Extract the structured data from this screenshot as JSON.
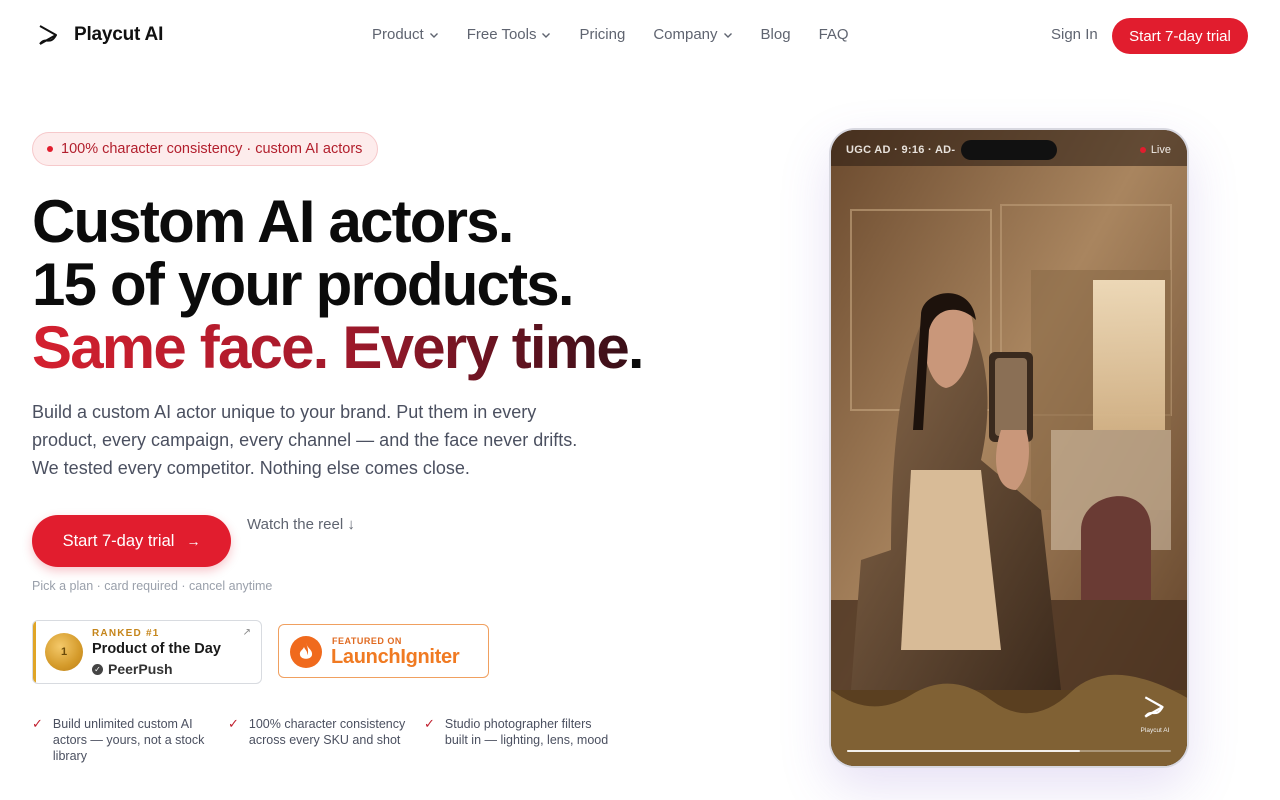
{
  "nav": {
    "brand": "Playcut AI",
    "items": [
      {
        "label": "Product",
        "dropdown": true
      },
      {
        "label": "Free Tools",
        "dropdown": true
      },
      {
        "label": "Pricing",
        "dropdown": false
      },
      {
        "label": "Company",
        "dropdown": true
      },
      {
        "label": "Blog",
        "dropdown": false
      },
      {
        "label": "FAQ",
        "dropdown": false
      }
    ],
    "sign_in": "Sign In",
    "cta": "Start 7-day trial"
  },
  "hero": {
    "badge": "100% character consistency · custom AI actors",
    "headline_line1": "Custom AI actors.",
    "headline_line2": "15 of your products.",
    "headline_line3": "Same face. Every time",
    "headline_period": ".",
    "subtitle": "Build a custom AI actor unique to your brand. Put them in every product, every campaign, every channel — and the face never drifts. We tested every competitor. Nothing else comes close.",
    "cta_label": "Start 7-day trial",
    "cta_arrow": "→",
    "watch_reel": "Watch the reel ↓",
    "fine_print": "Pick a plan · card required · cancel anytime"
  },
  "awards": {
    "peerpush": {
      "rank": "RANKED #1",
      "title": "Product of the Day",
      "brand": "PeerPush",
      "medal_number": "1",
      "ext_icon": "↗"
    },
    "launchigniter": {
      "featured": "FEATURED ON",
      "name": "LaunchIgniter"
    }
  },
  "features": [
    {
      "text": "Build unlimited custom AI actors — yours, not a stock library"
    },
    {
      "text": "100% character consistency across every SKU and shot"
    },
    {
      "text": "Studio photographer filters built in — lighting, lens, mood"
    }
  ],
  "phone": {
    "meta": "UGC AD · 9:16 · AD-",
    "live": "Live",
    "watermark": "Playcut AI",
    "progress": 0.72
  },
  "colors": {
    "accent": "#e11d2e",
    "text_muted": "#5f6470"
  }
}
